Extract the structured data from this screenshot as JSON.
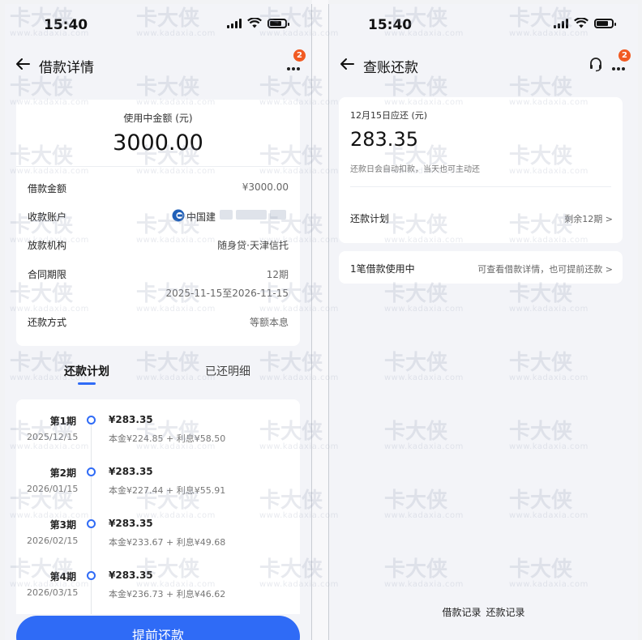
{
  "status_bar": {
    "time": "15:40"
  },
  "left": {
    "nav": {
      "title": "借款详情",
      "badge": "2"
    },
    "summary": {
      "amount_label": "使用中金额 (元)",
      "amount": "3000.00",
      "rows": {
        "loan_amount": {
          "label": "借款金额",
          "value": "¥3000.00"
        },
        "account": {
          "label": "收款账户",
          "value": "中国建"
        },
        "institution": {
          "label": "放款机构",
          "value": "随身贷·天津信托"
        },
        "term": {
          "label": "合同期限",
          "value": "12期",
          "range": "2025-11-15至2026-11-15"
        },
        "method": {
          "label": "还款方式",
          "value": "等额本息"
        }
      }
    },
    "tabs": {
      "active": "还款计划",
      "inactive": "已还明细"
    },
    "plan": [
      {
        "period": "第1期",
        "date": "2025/12/15",
        "amount": "¥283.35",
        "detail": "本金¥224.85 + 利息¥58.50"
      },
      {
        "period": "第2期",
        "date": "2026/01/15",
        "amount": "¥283.35",
        "detail": "本金¥227.44 + 利息¥55.91"
      },
      {
        "period": "第3期",
        "date": "2026/02/15",
        "amount": "¥283.35",
        "detail": "本金¥233.67 + 利息¥49.68"
      },
      {
        "period": "第4期",
        "date": "2026/03/15",
        "amount": "¥283.35",
        "detail": "本金¥236.73 + 利息¥46.62"
      }
    ],
    "repay_button": "提前还款"
  },
  "right": {
    "nav": {
      "title": "查账还款",
      "badge": "2"
    },
    "due": {
      "label": "12月15日应还 (元)",
      "amount": "283.35",
      "note": "还款日会自动扣款，当天也可主动还",
      "plan_label": "还款计划",
      "plan_value": "剩余12期 >"
    },
    "using": {
      "label": "1笔借款使用中",
      "value": "可查看借款详情，也可提前还款 >"
    },
    "footer": {
      "loan_records": "借款记录",
      "repay_records": "还款记录"
    }
  },
  "watermark": {
    "brand": "卡大侠",
    "site": "www.kadaxia.com"
  },
  "colors": {
    "accent": "#2f6bf6",
    "badge": "#f15a22",
    "background": "#f3f4f8"
  }
}
